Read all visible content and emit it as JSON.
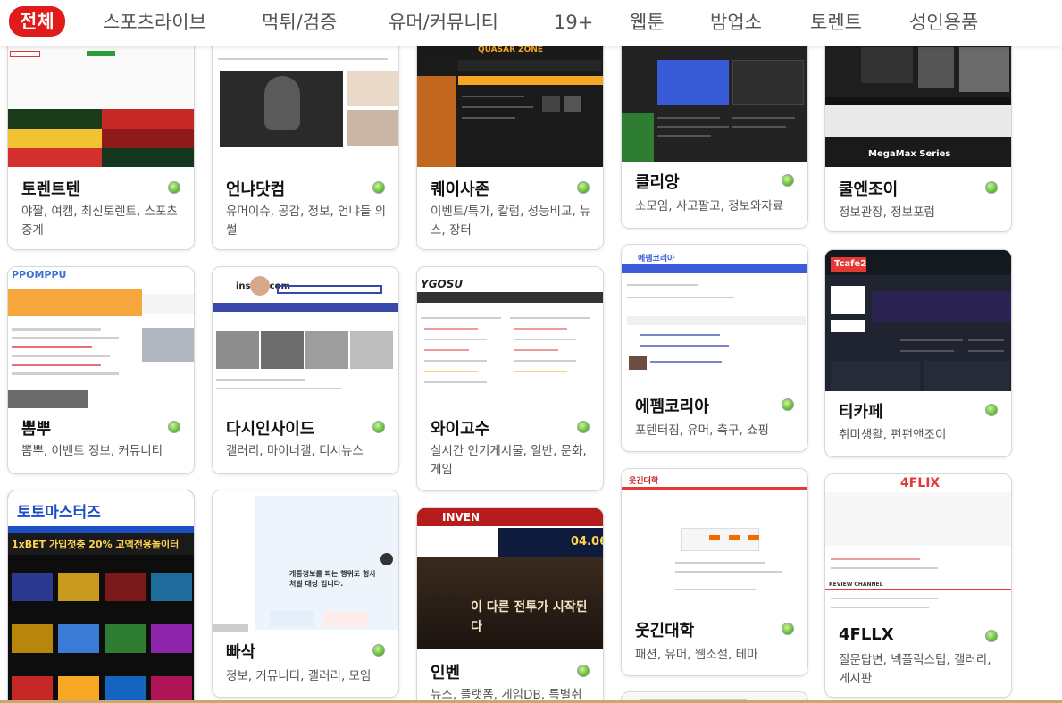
{
  "nav": {
    "items": [
      "전체",
      "스포츠라이브",
      "먹튀/검증",
      "유머/커뮤니티",
      "19+",
      "웹툰",
      "밤업소",
      "토렌트",
      "성인용품"
    ],
    "active_index": 0,
    "active_color": "#e11a1a"
  },
  "cards": [
    {
      "title": "토렌트텐",
      "desc": "야짤, 여캠, 최신토렌트, 스포츠중계",
      "status": "online"
    },
    {
      "title": "언냐닷컴",
      "desc": "유머이슈, 공감, 정보, 언냐들 의썰",
      "status": "online"
    },
    {
      "title": "퀘이사존",
      "desc": "이벤트/특가, 칼럼, 성능비교, 뉴스, 장터",
      "status": "online",
      "thumb_text": "QUASAR ZONE"
    },
    {
      "title": "클리앙",
      "desc": "소모임, 사고팔고, 정보와자료",
      "status": "online"
    },
    {
      "title": "쿨엔조이",
      "desc": "정보관장, 정보포럼",
      "status": "online",
      "thumb_text": "MegaMax Series"
    },
    {
      "title": "뽐뿌",
      "desc": "뽐뿌, 이벤트 정보, 커뮤니티",
      "status": "online",
      "thumb_text": "PPOMPPU"
    },
    {
      "title": "다시인사이드",
      "desc": "갤러리, 마이너갤, 디시뉴스",
      "status": "online",
      "thumb_text": "inside.com"
    },
    {
      "title": "와이고수",
      "desc": "실시간 인기게시물, 일반, 문화, 게임",
      "status": "online",
      "thumb_text": "YGOSU"
    },
    {
      "title": "에펨코리아",
      "desc": "포텐터짐, 유머, 축구, 쇼핑",
      "status": "online",
      "thumb_text": "에펨코리아"
    },
    {
      "title": "티카페",
      "desc": "취미생활, 펀펀앤조이",
      "status": "online",
      "thumb_text": "Tcafe2"
    },
    {
      "title": "빠삭",
      "desc": "정보, 커뮤니티, 갤러리, 모임",
      "status": "online"
    },
    {
      "title": "웃긴대학",
      "desc": "패션, 유머, 웹소설, 테마",
      "status": "online",
      "thumb_text": "웃긴대학"
    },
    {
      "title": "4FLLX",
      "desc": "질문답변, 넥플릭스팁, 갤러리, 게시판",
      "status": "online",
      "thumb_text": "4FLIX",
      "thumb_sub": "REVIEW CHANNEL"
    },
    {
      "title": "인벤",
      "desc": "뉴스, 플랫폼, 게임DB, 특별취",
      "status": "online",
      "thumb_text": "INVEN",
      "thumb_sub": "04.06",
      "thumb_banner": "이 다른 전투가 시작된다"
    }
  ],
  "thumbs": {
    "toto_banner": "토토마스터즈",
    "toto_bet": "1xBET 가입첫충 20% 고액전용놀이터",
    "bbasak_notice": "개통정보를 파는 행위도 형사처벌 대상 입니다."
  }
}
